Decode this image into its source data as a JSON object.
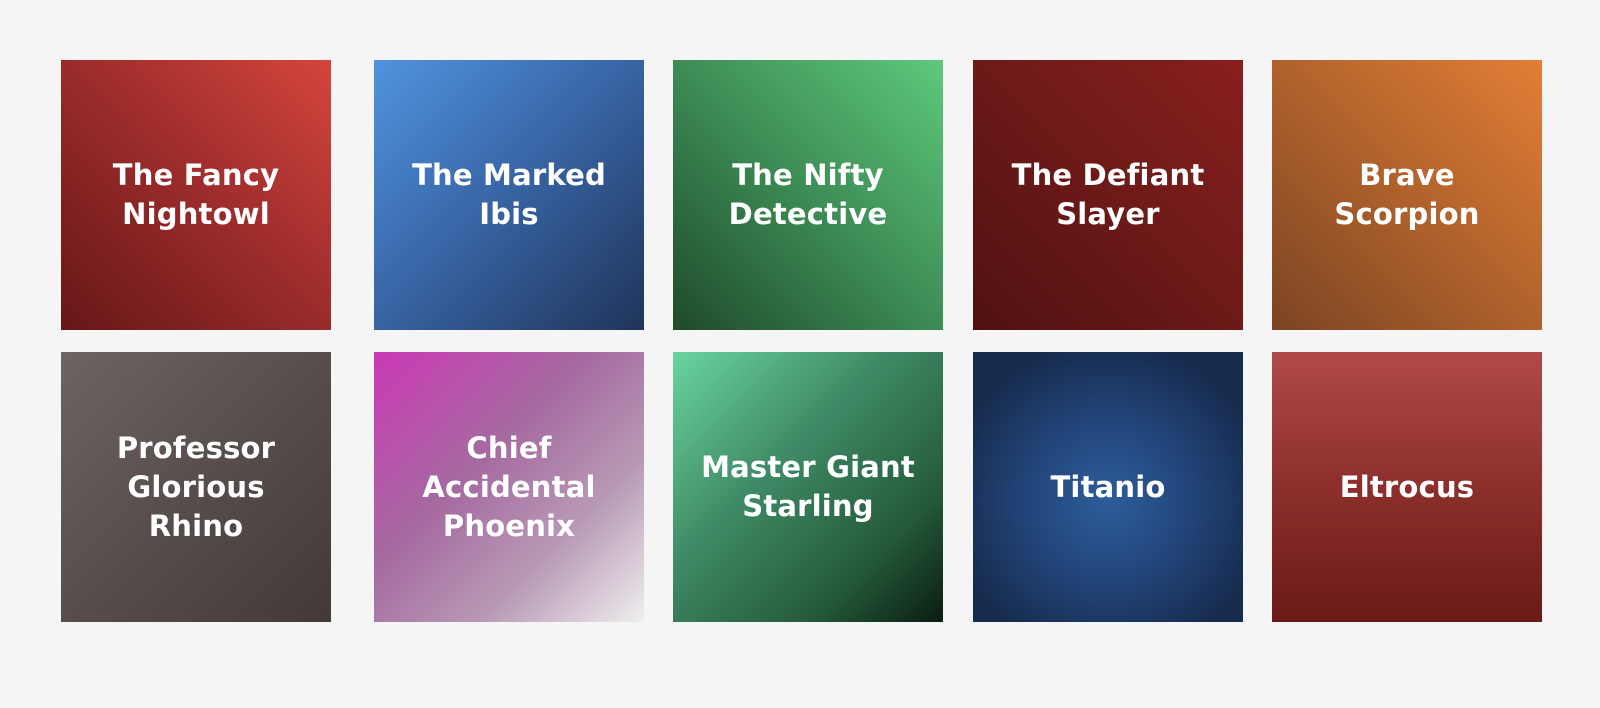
{
  "tiles": [
    {
      "label": "The Fancy Nightowl"
    },
    {
      "label": "The Marked Ibis"
    },
    {
      "label": "The Nifty Detective"
    },
    {
      "label": "The Defiant Slayer"
    },
    {
      "label": "Brave Scorpion"
    },
    {
      "label": "Professor Glorious Rhino"
    },
    {
      "label": "Chief Accidental Phoenix"
    },
    {
      "label": "Master Giant Starling"
    },
    {
      "label": "Titanio"
    },
    {
      "label": "Eltrocus"
    }
  ],
  "colors": {
    "page_background": "#f5f5f5",
    "label_text": "#ffffff"
  }
}
